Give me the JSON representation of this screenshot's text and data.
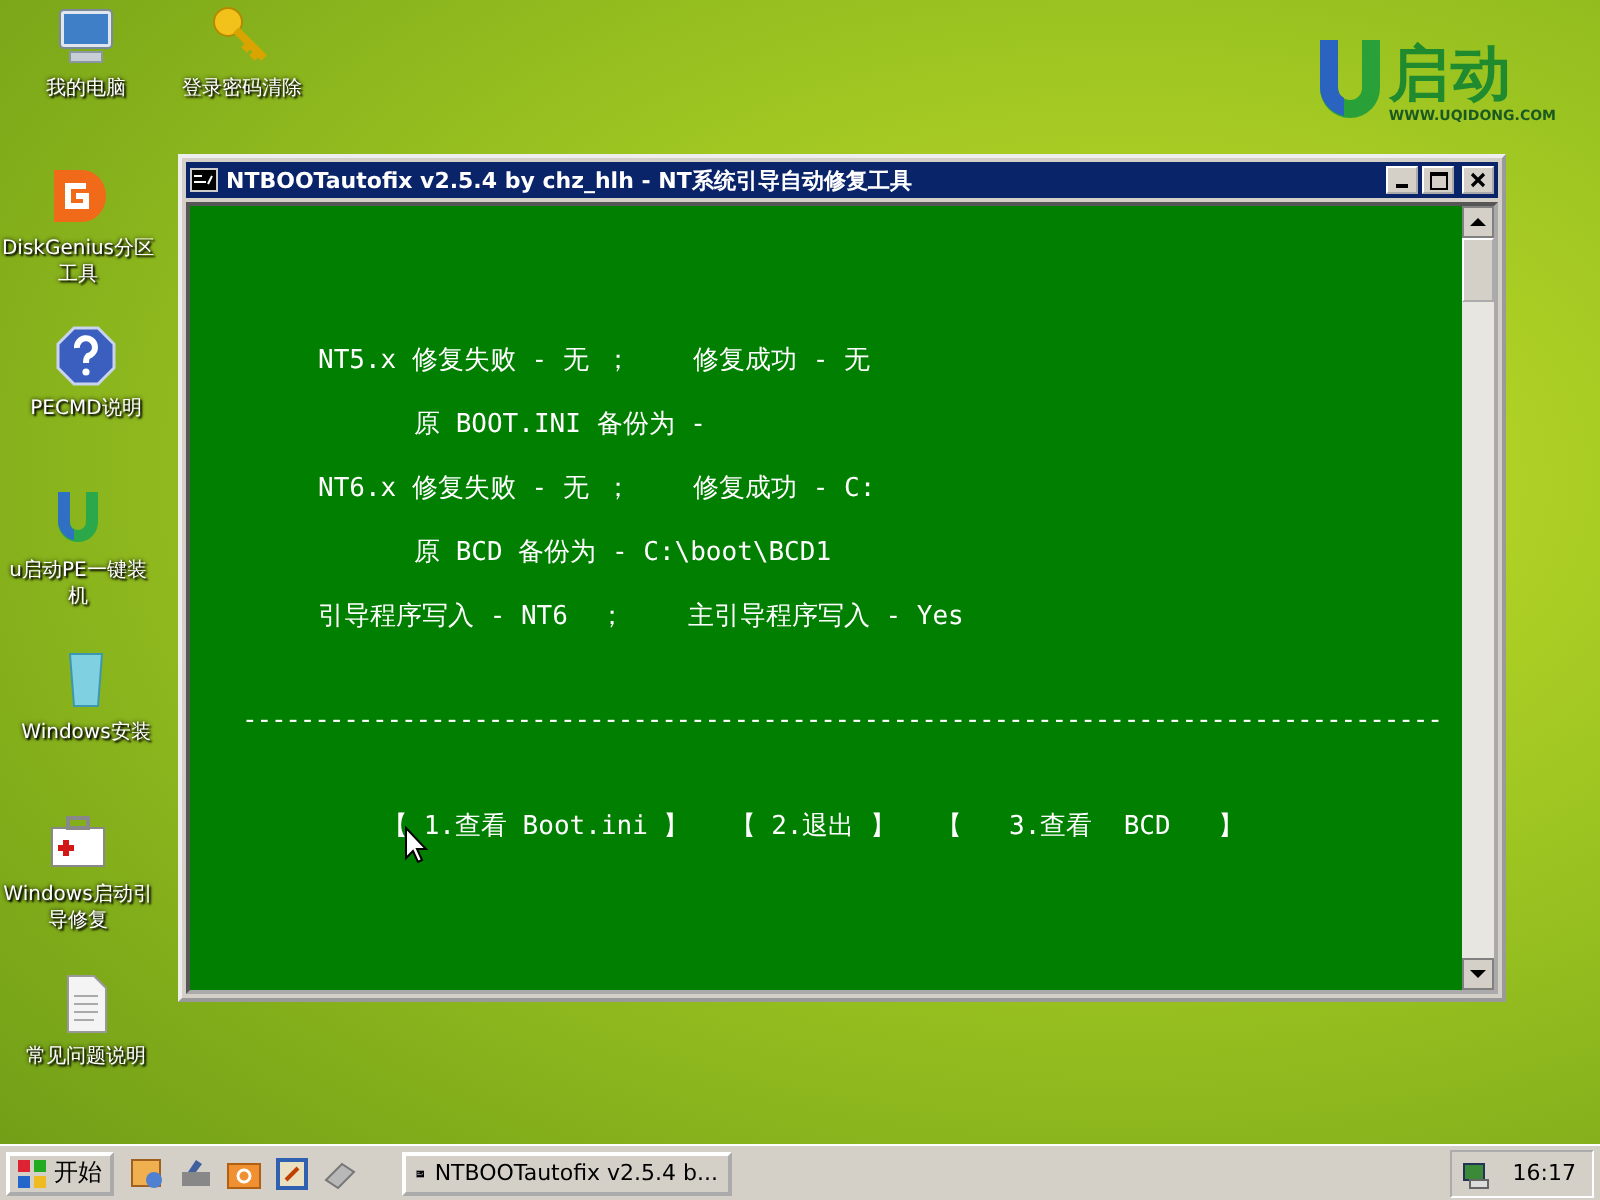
{
  "desktop_icons": [
    {
      "label": "我的电脑",
      "kind": "computer"
    },
    {
      "label": "登录密码清除",
      "kind": "key"
    },
    {
      "label": "DiskGenius分区工具",
      "kind": "disk"
    },
    {
      "label": "PECMD说明",
      "kind": "help"
    },
    {
      "label": "u启动PE一键装机",
      "kind": "ulogo"
    },
    {
      "label": "Windows安装",
      "kind": "winsetup"
    },
    {
      "label": "Windows启动引导修复",
      "kind": "toolbox"
    },
    {
      "label": "常见问题说明",
      "kind": "document"
    }
  ],
  "logo": {
    "brand": "启动",
    "url": "WWW.UQIDONG.COM"
  },
  "window": {
    "title": "NTBOOTautofix v2.5.4 by chz_hlh - NT系统引导自动修复工具",
    "lines": [
      {
        "kind": "main",
        "text": "NT5.x 修复失败 - 无 ；    修复成功 - 无"
      },
      {
        "kind": "sub",
        "text": "原 BOOT.INI 备份为 -"
      },
      {
        "kind": "main",
        "text": "NT6.x 修复失败 - 无 ；    修复成功 - C:"
      },
      {
        "kind": "sub",
        "text": "原 BCD 备份为 - C:\\boot\\BCD1"
      },
      {
        "kind": "main",
        "text": "引导程序写入 - NT6  ；    主引导程序写入 - Yes"
      }
    ],
    "separator": "-----------------------------------------------------------------------------------",
    "menu": [
      "【 1.查看 Boot.ini 】",
      "【 2.退出 】",
      "【   3.查看  BCD   】"
    ]
  },
  "taskbar": {
    "start": "开始",
    "tasks": [
      {
        "label": "NTBOOTautofix v2.5.4 b...",
        "selected": false
      }
    ],
    "clock": "16:17"
  }
}
